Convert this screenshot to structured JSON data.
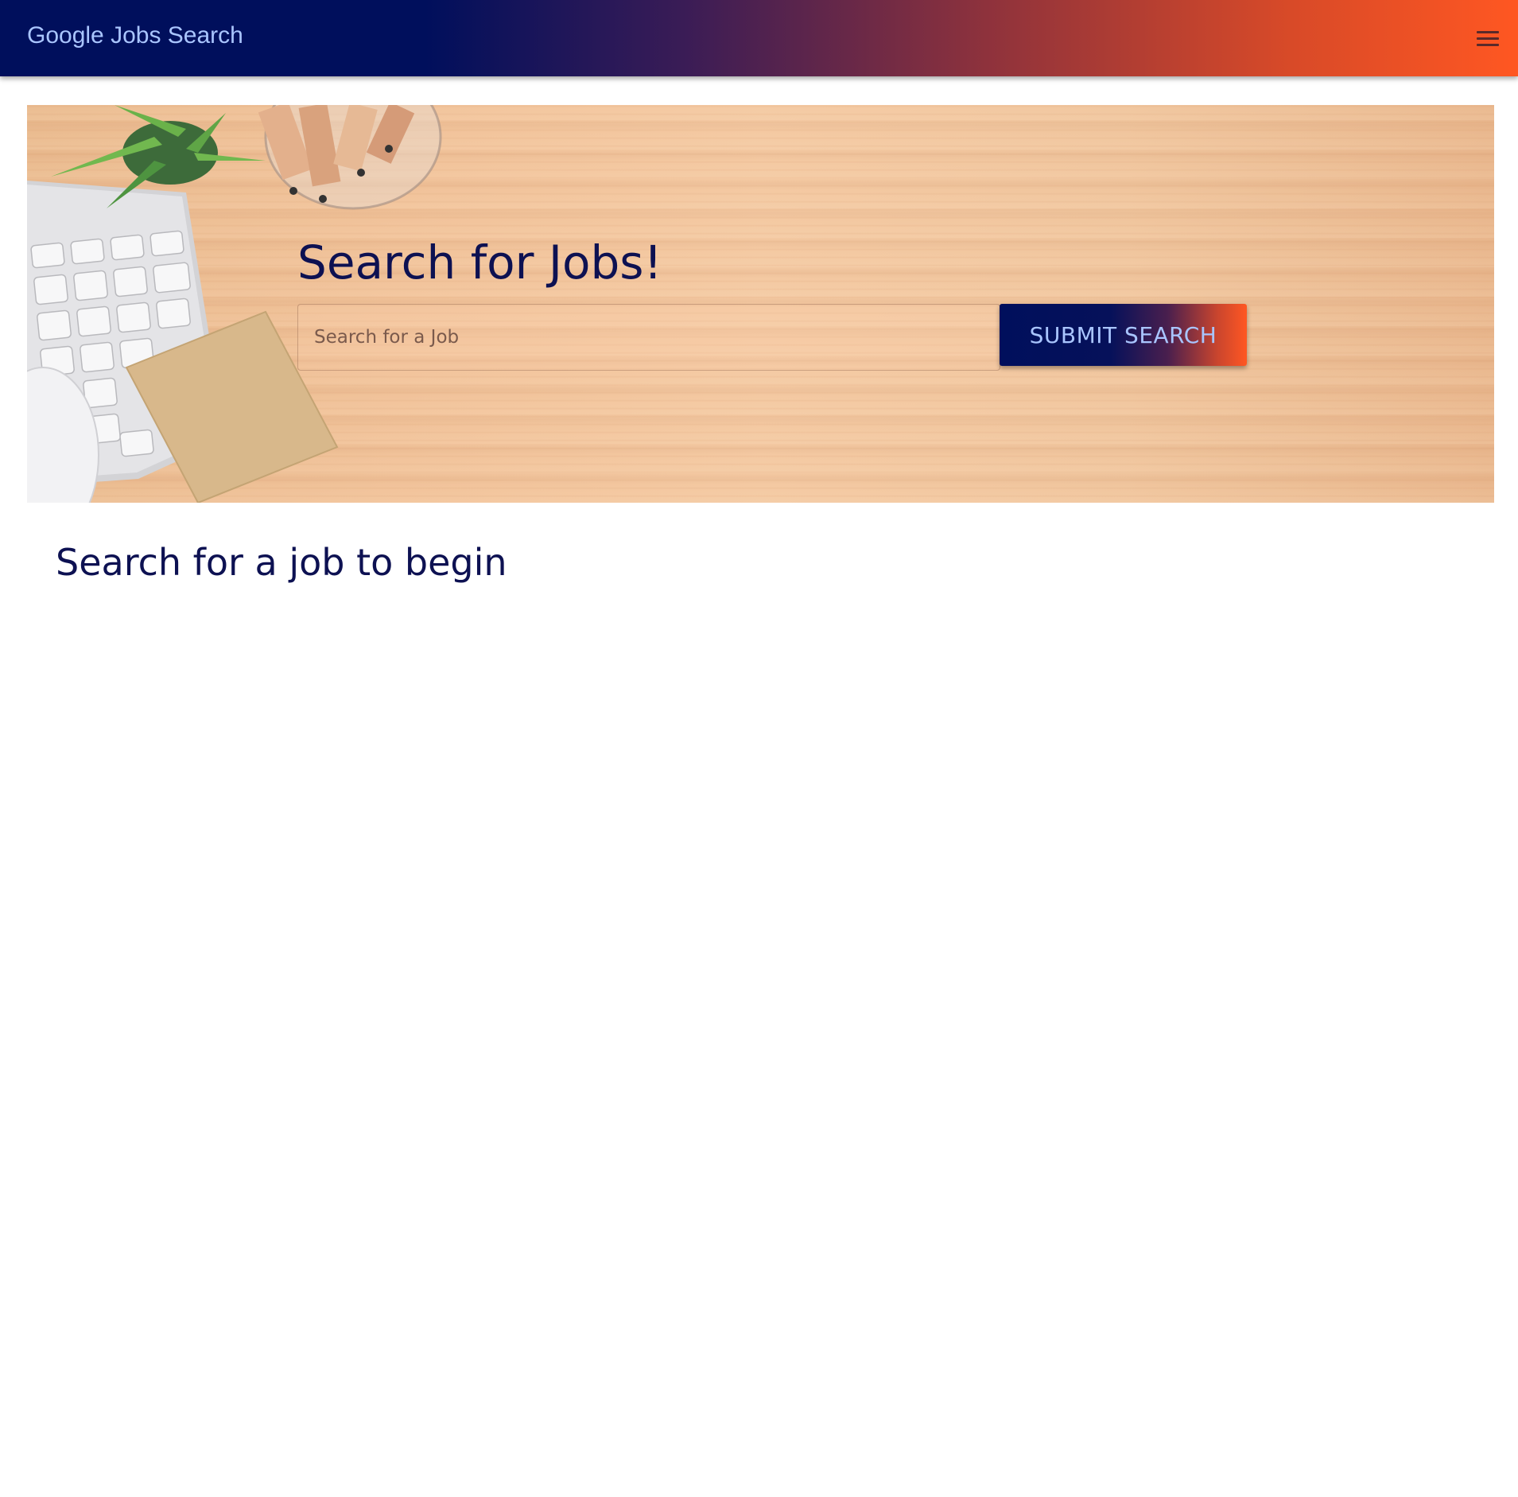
{
  "appbar": {
    "title": "Google Jobs Search",
    "menu_icon": "hamburger-menu-icon",
    "gradient_start": "#000f5c",
    "gradient_end": "#ff5722",
    "title_color": "#a9c5ff"
  },
  "hero": {
    "heading": "Search for Jobs!",
    "search": {
      "value": "",
      "placeholder": "Search for a Job"
    },
    "submit_label": "SUBMIT SEARCH",
    "text_color": "#0d1152"
  },
  "results": {
    "empty_message": "Search for a job to begin"
  }
}
